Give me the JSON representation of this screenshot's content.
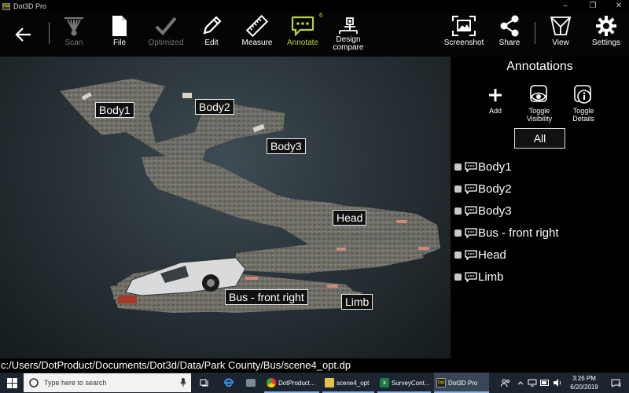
{
  "window": {
    "title": "Dot3D Pro",
    "app_icon_text": "Dot",
    "minimize": "–",
    "maximize": "❐",
    "close": "✕"
  },
  "toolbar": {
    "back_icon": "back-arrow-icon",
    "scan": "Scan",
    "file": "File",
    "optimized": "Optimized",
    "edit": "Edit",
    "measure": "Measure",
    "annotate": "Annotate",
    "annotate_badge": "6",
    "design_compare_line1": "Design",
    "design_compare_line2": "compare",
    "screenshot": "Screenshot",
    "share": "Share",
    "view": "View",
    "settings": "Settings",
    "accent_color": "#b7d43a"
  },
  "scene": {
    "labels": [
      "Body1",
      "Body2",
      "Body3",
      "Head",
      "Bus - front right",
      "Limb"
    ]
  },
  "panel": {
    "title": "Annotations",
    "add": "Add",
    "toggle_visibility_line1": "Toggle",
    "toggle_visibility_line2": "Visibility",
    "toggle_details_line1": "Toggle",
    "toggle_details_line2": "Details",
    "filter": "All",
    "items": [
      "Body1",
      "Body2",
      "Body3",
      "Bus - front right",
      "Head",
      "Limb"
    ]
  },
  "path": "c:/Users/DotProduct/Documents/Dot3d/Data/Park County/Bus/scene4_opt.dp",
  "taskbar": {
    "search_placeholder": "Type here to search",
    "apps": [
      "DotProduct...",
      "scene4_opt",
      "SurveyCont...",
      "Dot3D Pro"
    ],
    "time": "3:26 PM",
    "date": "6/20/2019",
    "notification_count": "3"
  }
}
